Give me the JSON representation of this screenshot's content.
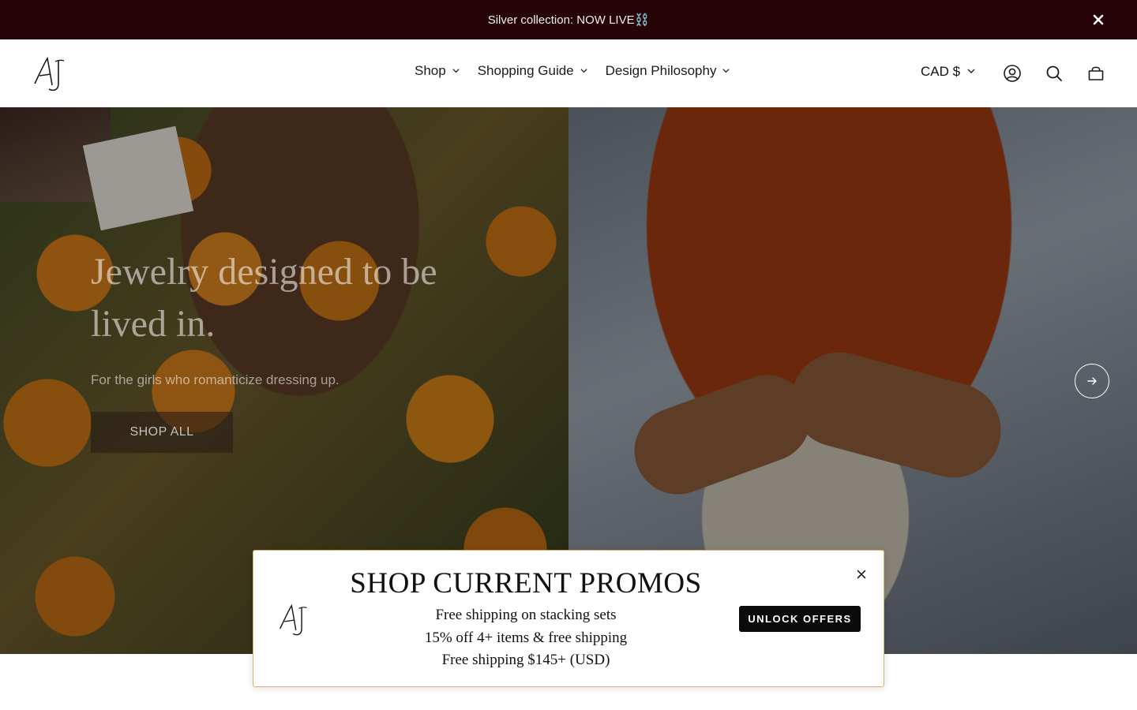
{
  "announcement": {
    "text": "Silver collection: NOW LIVE⛓️"
  },
  "header": {
    "logo_text": "AJ",
    "nav": [
      {
        "label": "Shop"
      },
      {
        "label": "Shopping Guide"
      },
      {
        "label": "Design Philosophy"
      }
    ],
    "currency": "CAD $",
    "icons": [
      "account-icon",
      "search-icon",
      "cart-icon"
    ]
  },
  "hero": {
    "title": "Jewelry designed to be lived in.",
    "subtitle": "For the girls who romanticize dressing up.",
    "button_label": "SHOP ALL"
  },
  "promo": {
    "title": "SHOP CURRENT PROMOS",
    "lines": [
      "Free shipping on stacking sets",
      "15% off 4+ items & free shipping",
      "Free shipping $145+ (USD)"
    ],
    "cta_label": "UNLOCK OFFERS"
  },
  "colors": {
    "announcement_bg": "#250306",
    "promo_border": "#d7b46a",
    "cta_bg": "#0b0b0b"
  }
}
